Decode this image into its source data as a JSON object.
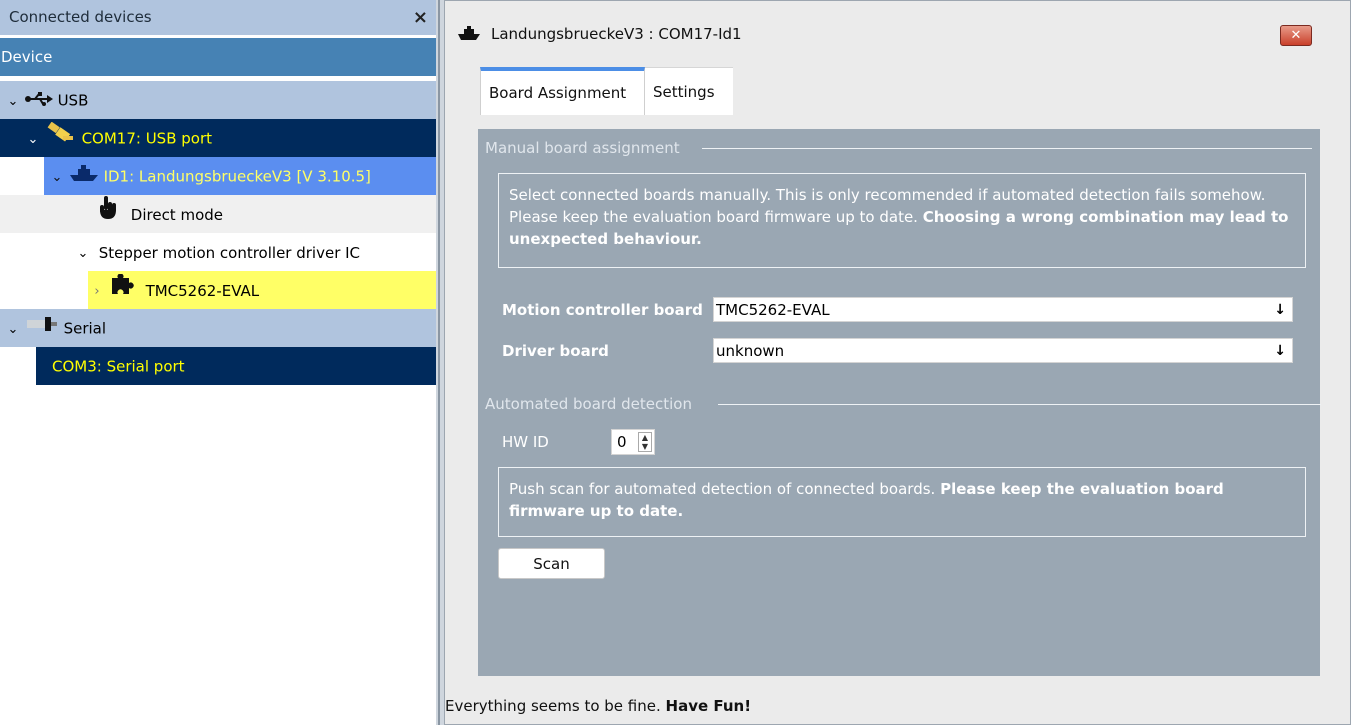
{
  "left_panel": {
    "title": "Connected devices",
    "close_label": "×",
    "column_header": "Device",
    "tree": {
      "usb": {
        "label": "USB",
        "icon": "usb-icon"
      },
      "com17": {
        "label": "COM17: USB port",
        "icon": "usb-plug-icon"
      },
      "id1": {
        "label": "ID1: LandungsbrueckeV3 [V 3.10.5]",
        "icon": "ship-icon"
      },
      "direct_mode": {
        "label": "Direct mode",
        "icon": "hand-pointer-icon"
      },
      "stepper": {
        "label": "Stepper motion controller driver IC"
      },
      "tmc5262": {
        "label": "TMC5262-EVAL",
        "icon": "puzzle-icon"
      },
      "serial": {
        "label": "Serial",
        "icon": "serial-plug-icon"
      },
      "com3": {
        "label": "COM3: Serial port"
      }
    }
  },
  "window": {
    "title": "LandungsbrueckeV3 : COM17-Id1",
    "close_label": "✕",
    "tabs": [
      {
        "label": "Board Assignment",
        "active": true
      },
      {
        "label": "Settings",
        "active": false
      }
    ],
    "manual": {
      "group_title": "Manual board assignment",
      "info_normal": "Select connected boards manually. This is only recommended if automated detection fails somehow. Please keep the evaluation board firmware up to date. ",
      "info_bold": "Choosing a wrong combination may lead to unexpected behaviour.",
      "motion_label": "Motion controller board",
      "motion_value": "TMC5262-EVAL",
      "driver_label": "Driver board",
      "driver_value": "unknown",
      "dropdown_arrow": "↓"
    },
    "auto": {
      "group_title": "Automated board detection",
      "hwid_label": "HW ID",
      "hwid_value": "0",
      "info_normal": "Push scan for automated detection of connected boards. ",
      "info_bold": "Please keep the evaluation board firmware up to date.",
      "scan_label": "Scan"
    },
    "status": {
      "normal": "Everything seems to be fine. ",
      "bold": "Have Fun!"
    }
  },
  "colors": {
    "header_light": "#b0c4de",
    "header_dark": "#4682b4",
    "navy": "#002a5c",
    "selected_blue": "#5b8ef0",
    "highlight_yellow": "#ffff66",
    "text_yellow": "#ffff00",
    "panel_gray": "#9aa7b3"
  }
}
